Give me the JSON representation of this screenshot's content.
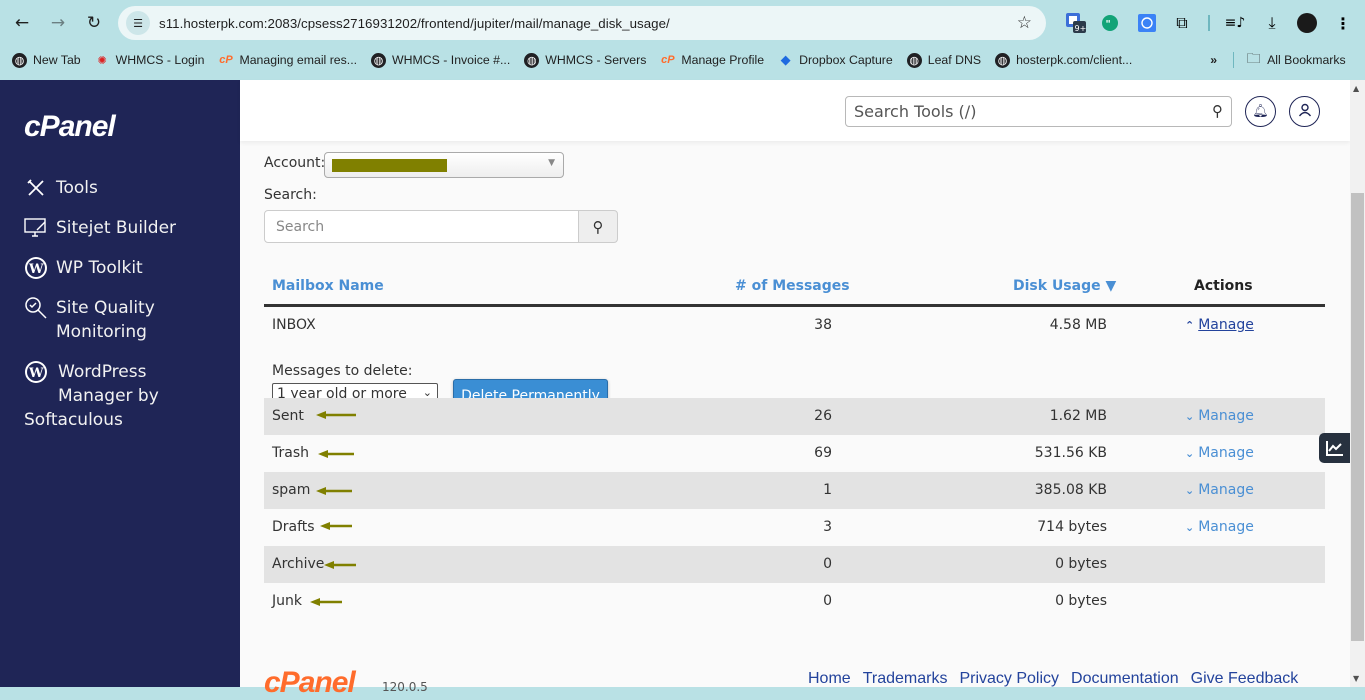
{
  "browser": {
    "url": "s11.hosterpk.com:2083/cpsess2716931202/frontend/jupiter/mail/manage_disk_usage/",
    "extension_badge": "9+",
    "bookmarks": [
      {
        "label": "New Tab",
        "icon": "globe-icon"
      },
      {
        "label": "WHMCS - Login",
        "icon": "whmcs-icon"
      },
      {
        "label": "Managing email res...",
        "icon": "cpanel-icon"
      },
      {
        "label": "WHMCS - Invoice #...",
        "icon": "globe-icon"
      },
      {
        "label": "WHMCS - Servers",
        "icon": "globe-icon"
      },
      {
        "label": "Manage Profile",
        "icon": "cpanel-icon"
      },
      {
        "label": "Dropbox Capture",
        "icon": "dropbox-icon"
      },
      {
        "label": "Leaf DNS",
        "icon": "globe-icon"
      },
      {
        "label": "hosterpk.com/client...",
        "icon": "globe-icon"
      }
    ],
    "more_bookmarks": "»",
    "all_bookmarks": "All Bookmarks"
  },
  "sidebar": {
    "logo": "cPanel",
    "items": [
      {
        "label": "Tools",
        "icon": "tools-icon"
      },
      {
        "label": "Sitejet Builder",
        "icon": "sitejet-icon"
      },
      {
        "label": "WP Toolkit",
        "icon": "wordpress-icon"
      },
      {
        "label": "Site Quality Monitoring",
        "line1": "Site Quality",
        "line2": "Monitoring",
        "icon": "site-quality-icon"
      },
      {
        "label": "WordPress Manager by Softaculous",
        "line1": "WordPress",
        "line2": "Manager by",
        "line3": "Softaculous",
        "icon": "wordpress-icon"
      }
    ]
  },
  "header": {
    "search_placeholder": "Search Tools (/)"
  },
  "form": {
    "account_label": "Account:",
    "account_value": "[redacted]",
    "search_label": "Search:",
    "search_placeholder": "Search"
  },
  "table": {
    "headers": {
      "name": "Mailbox Name",
      "messages": "# of Messages",
      "disk": "Disk Usage ▼",
      "actions": "Actions"
    },
    "expanded": {
      "delete_label": "Messages to delete:",
      "delete_option": "1 year old or more",
      "delete_button": "Delete Permanently"
    },
    "rows": [
      {
        "name": "INBOX",
        "messages": "38",
        "disk": "4.58 MB",
        "action": "Manage",
        "expanded": true
      },
      {
        "name": "Sent",
        "messages": "26",
        "disk": "1.62 MB",
        "action": "Manage"
      },
      {
        "name": "Trash",
        "messages": "69",
        "disk": "531.56 KB",
        "action": "Manage"
      },
      {
        "name": "spam",
        "messages": "1",
        "disk": "385.08 KB",
        "action": "Manage"
      },
      {
        "name": "Drafts",
        "messages": "3",
        "disk": "714 bytes",
        "action": "Manage"
      },
      {
        "name": "Archive",
        "messages": "0",
        "disk": "0 bytes",
        "action": ""
      },
      {
        "name": "Junk",
        "messages": "0",
        "disk": "0 bytes",
        "action": ""
      }
    ]
  },
  "footer": {
    "logo": "cPanel",
    "version": "120.0.5",
    "links": [
      "Home",
      "Trademarks",
      "Privacy Policy",
      "Documentation",
      "Give Feedback"
    ]
  },
  "colors": {
    "sidebar_bg": "#1f2556",
    "link": "#4a8fd4",
    "primary_button": "#3a8ed4",
    "annotation_arrow": "#808000",
    "cpanel_orange": "#ff6c2c"
  }
}
